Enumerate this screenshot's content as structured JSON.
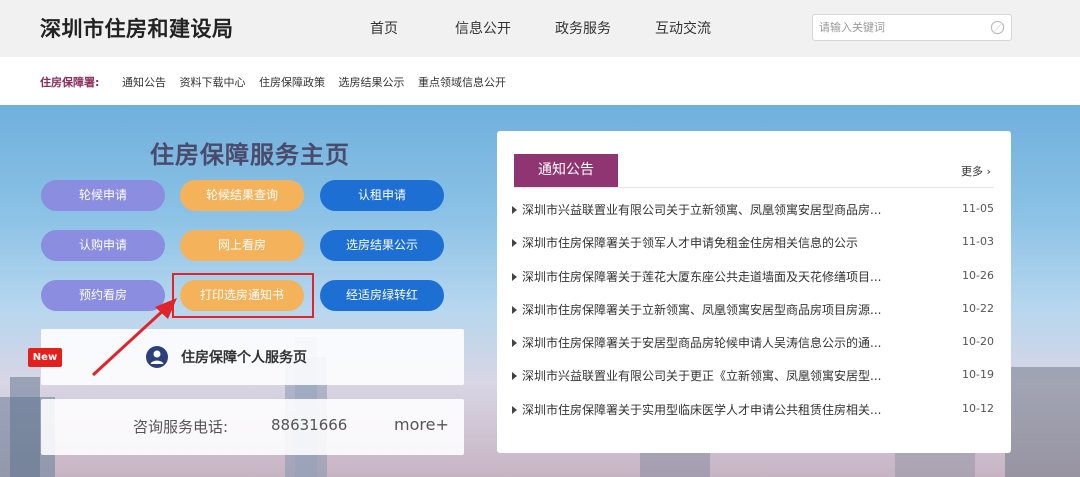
{
  "header": {
    "logo": "深圳市住房和建设局",
    "nav": [
      "首页",
      "信息公开",
      "政务服务",
      "互动交流"
    ],
    "search_placeholder": "请输入关键词"
  },
  "subnav": {
    "title": "住房保障署:",
    "links": [
      "通知公告",
      "资料下载中心",
      "住房保障政策",
      "选房结果公示",
      "重点领域信息公开"
    ]
  },
  "hero": {
    "title": "住房保障服务主页",
    "buttons": [
      {
        "label": "轮候申请",
        "color": "purple"
      },
      {
        "label": "轮候结果查询",
        "color": "orange"
      },
      {
        "label": "认租申请",
        "color": "blue"
      },
      {
        "label": "认购申请",
        "color": "purple"
      },
      {
        "label": "网上看房",
        "color": "orange"
      },
      {
        "label": "选房结果公示",
        "color": "blue"
      },
      {
        "label": "预约看房",
        "color": "purple"
      },
      {
        "label": "打印选房通知书",
        "color": "orange"
      },
      {
        "label": "经适房绿转红",
        "color": "blue"
      }
    ],
    "new_badge": "New",
    "personal_service": "住房保障个人服务页",
    "phone_label": "咨询服务电话:",
    "phone_number": "88631666",
    "more": "more+"
  },
  "notice": {
    "tab": "通知公告",
    "more": "更多 ›",
    "items": [
      {
        "title": "深圳市兴益联置业有限公司关于立新领寓、凤凰领寓安居型商品房...",
        "date": "11-05"
      },
      {
        "title": "深圳市住房保障署关于领军人才申请免租金住房相关信息的公示",
        "date": "11-03"
      },
      {
        "title": "深圳市住房保障署关于莲花大厦东座公共走道墙面及天花修缮项目...",
        "date": "10-26"
      },
      {
        "title": "深圳市住房保障署关于立新领寓、凤凰领寓安居型商品房项目房源...",
        "date": "10-22"
      },
      {
        "title": "深圳市住房保障署关于安居型商品房轮候申请人吴涛信息公示的通...",
        "date": "10-20"
      },
      {
        "title": "深圳市兴益联置业有限公司关于更正《立新领寓、凤凰领寓安居型...",
        "date": "10-19"
      },
      {
        "title": "深圳市住房保障署关于实用型临床医学人才申请公共租赁住房相关...",
        "date": "10-12"
      }
    ]
  },
  "colors": {
    "brand_purple": "#8f3571",
    "button_purple": "#8a8de0",
    "button_orange": "#f4b25b",
    "button_blue": "#1d6fd3",
    "highlight_red": "#e0252a"
  }
}
